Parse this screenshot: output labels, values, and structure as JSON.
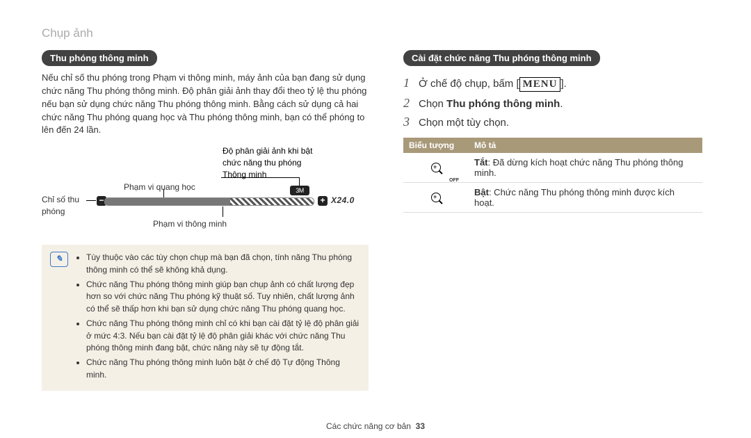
{
  "section_title": "Chụp ảnh",
  "left": {
    "heading": "Thu phóng thông minh",
    "paragraph": "Nếu chỉ số thu phóng trong Phạm vi thông minh, máy ảnh của bạn đang sử dụng chức năng Thu phóng thông minh. Độ phân giải ảnh thay đổi theo tỷ lệ thu phóng nếu bạn sử dụng chức năng Thu phóng thông minh. Bằng cách sử dụng cả hai chức năng Thu phóng quang học và Thu phóng thông minh, bạn có thể phóng to lên đến 24 lần.",
    "diagram": {
      "zoom_indicator": "Chỉ số thu phóng",
      "optical_range": "Phạm vi quang học",
      "resolution_note": "Độ phân giải ảnh khi bật chức năng thu phóng Thông minh",
      "smart_range": "Phạm vi thông minh",
      "zoom_text": "X24.0",
      "minus": "−",
      "plus": "+",
      "res_badge": "3M"
    },
    "notes": [
      "Tùy thuộc vào các tùy chọn chụp mà bạn đã chọn, tính năng Thu phóng thông minh có thể sẽ không khả dụng.",
      "Chức năng Thu phóng thông minh giúp bạn chụp ảnh có chất lượng đẹp hơn so với chức năng Thu phóng kỹ thuật số. Tuy nhiên, chất lượng ảnh có thể sẽ thấp hơn khi bạn sử dụng chức năng Thu phóng quang học.",
      "Chức năng Thu phóng thông minh chỉ có khi bạn cài đặt tỷ lệ độ phân giải ở mức 4:3. Nếu bạn cài đặt tỷ lệ độ phân giải khác với chức năng Thu phóng thông minh đang bật, chức năng này sẽ tự động tắt.",
      "Chức năng Thu phóng thông minh luôn bật ở chế độ Tự động Thông minh."
    ]
  },
  "right": {
    "heading": "Cài đặt chức năng Thu phóng thông minh",
    "steps": [
      {
        "num": "1",
        "prefix": "Ở chế độ chụp, bấm [",
        "menu": "MENU",
        "suffix": "]."
      },
      {
        "num": "2",
        "prefix": "Chọn ",
        "bold": "Thu phóng thông minh",
        "suffix": "."
      },
      {
        "num": "3",
        "prefix": "Chọn một tùy chọn.",
        "bold": "",
        "suffix": ""
      }
    ],
    "table": {
      "col1": "Biểu tượng",
      "col2": "Mô tả",
      "rows": [
        {
          "bold": "Tắt",
          "text": ": Đã dừng kích hoạt chức năng Thu phóng thông minh."
        },
        {
          "bold": "Bật",
          "text": ": Chức năng Thu phóng thông minh được kích hoạt."
        }
      ]
    }
  },
  "footer": {
    "label": "Các chức năng cơ bản",
    "page": "33"
  }
}
